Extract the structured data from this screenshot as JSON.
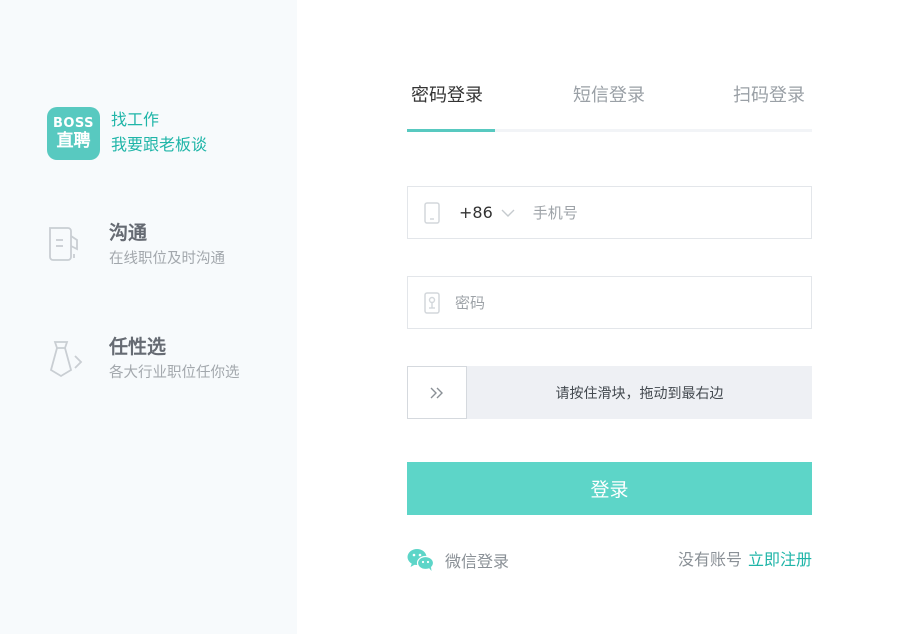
{
  "brand": {
    "logo_top": "BOSS",
    "logo_bottom": "直聘",
    "line1": "找工作",
    "line2": "我要跟老板谈"
  },
  "features": [
    {
      "title": "沟通",
      "desc": "在线职位及时沟通",
      "icon": "chat-document-icon"
    },
    {
      "title": "任性选",
      "desc": "各大行业职位任你选",
      "icon": "tie-icon"
    }
  ],
  "tabs": {
    "password": "密码登录",
    "sms": "短信登录",
    "qr": "扫码登录",
    "active": "password"
  },
  "phone": {
    "country_code": "+86",
    "placeholder": "手机号",
    "value": ""
  },
  "password": {
    "placeholder": "密码",
    "value": ""
  },
  "slider": {
    "hint": "请按住滑块，拖动到最右边",
    "handle_glyph": "»"
  },
  "login_button": "登录",
  "wechat_login": "微信登录",
  "register": {
    "prompt": "没有账号",
    "link": "立即注册"
  },
  "colors": {
    "accent": "#58c9c0",
    "accent_text": "#1fb5a8",
    "button": "#5dd5c8",
    "left_panel_bg": "#f7fafc"
  }
}
